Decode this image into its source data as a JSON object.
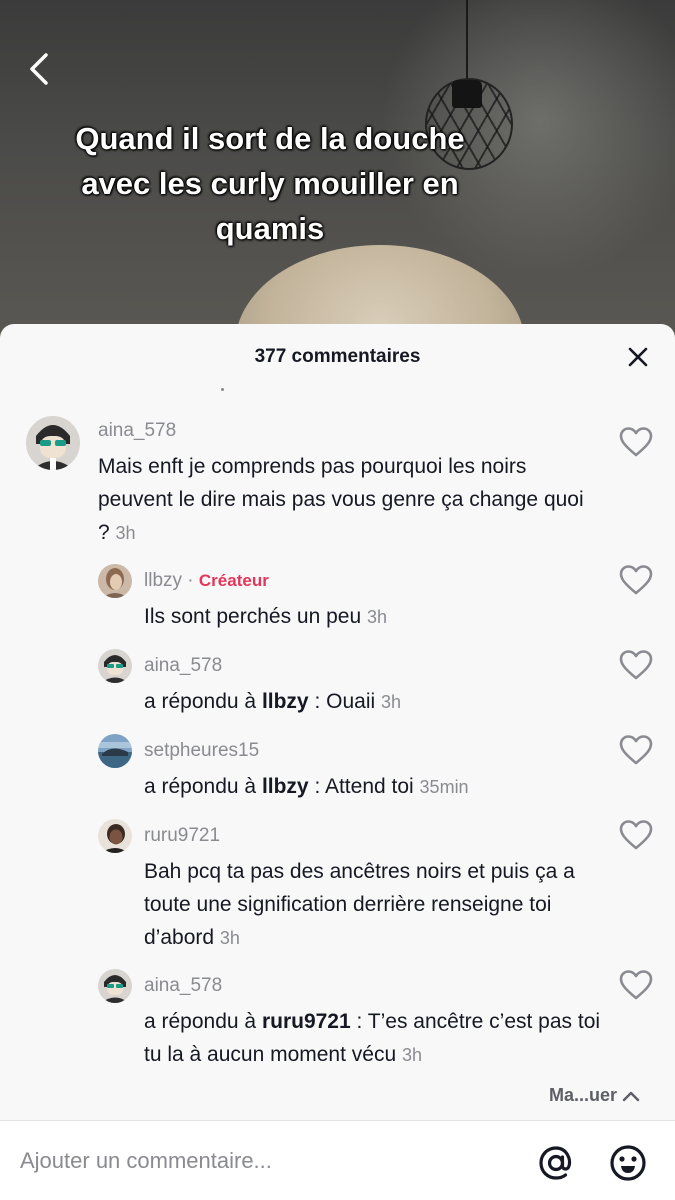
{
  "video": {
    "caption": "Quand il sort de la douche avec les curly mouiller en quamis",
    "back_icon": "chevron-left-icon"
  },
  "comments_panel": {
    "title": "377 commentaires",
    "close_icon": "close-icon",
    "collapse_label": "Ma...uer",
    "collapse_icon": "chevron-up-icon"
  },
  "comments": [
    {
      "username": "aina_578",
      "text": "Mais enft je comprends pas pourquoi les noirs peuvent le dire mais pas vous genre ça change quoi ?",
      "time": "3h",
      "like_icon": "heart-outline-icon"
    },
    {
      "username": "llbzy",
      "badge_sep": " · ",
      "badge": "Créateur",
      "text": "Ils sont perchés un peu",
      "time": "3h",
      "like_icon": "heart-outline-icon"
    },
    {
      "username": "aina_578",
      "reply_prefix": "a répondu à ",
      "reply_to": "llbzy",
      "text": " : Ouaii",
      "time": "3h",
      "like_icon": "heart-outline-icon"
    },
    {
      "username": "setpheures15",
      "reply_prefix": "a répondu à ",
      "reply_to": "llbzy",
      "text": " : Attend toi",
      "time": "35min",
      "like_icon": "heart-outline-icon"
    },
    {
      "username": "ruru9721",
      "text": "Bah pcq ta pas des ancêtres noirs et puis ça a toute une signification derrière renseigne toi d’abord",
      "time": "3h",
      "like_icon": "heart-outline-icon"
    },
    {
      "username": "aina_578",
      "reply_prefix": "a répondu à ",
      "reply_to": "ruru9721",
      "text": " : T’es ancêtre c’est pas toi tu la à aucun moment vécu",
      "time": "3h",
      "like_icon": "heart-outline-icon"
    }
  ],
  "input_bar": {
    "placeholder": "Ajouter un commentaire...",
    "value": "",
    "mention_icon": "at-sign-icon",
    "emoji_icon": "emoji-icon"
  },
  "colors": {
    "sheet_bg": "#f8f8f8",
    "text_primary": "#161823",
    "text_secondary": "#8a8b91",
    "creator_badge": "#e3365a"
  }
}
